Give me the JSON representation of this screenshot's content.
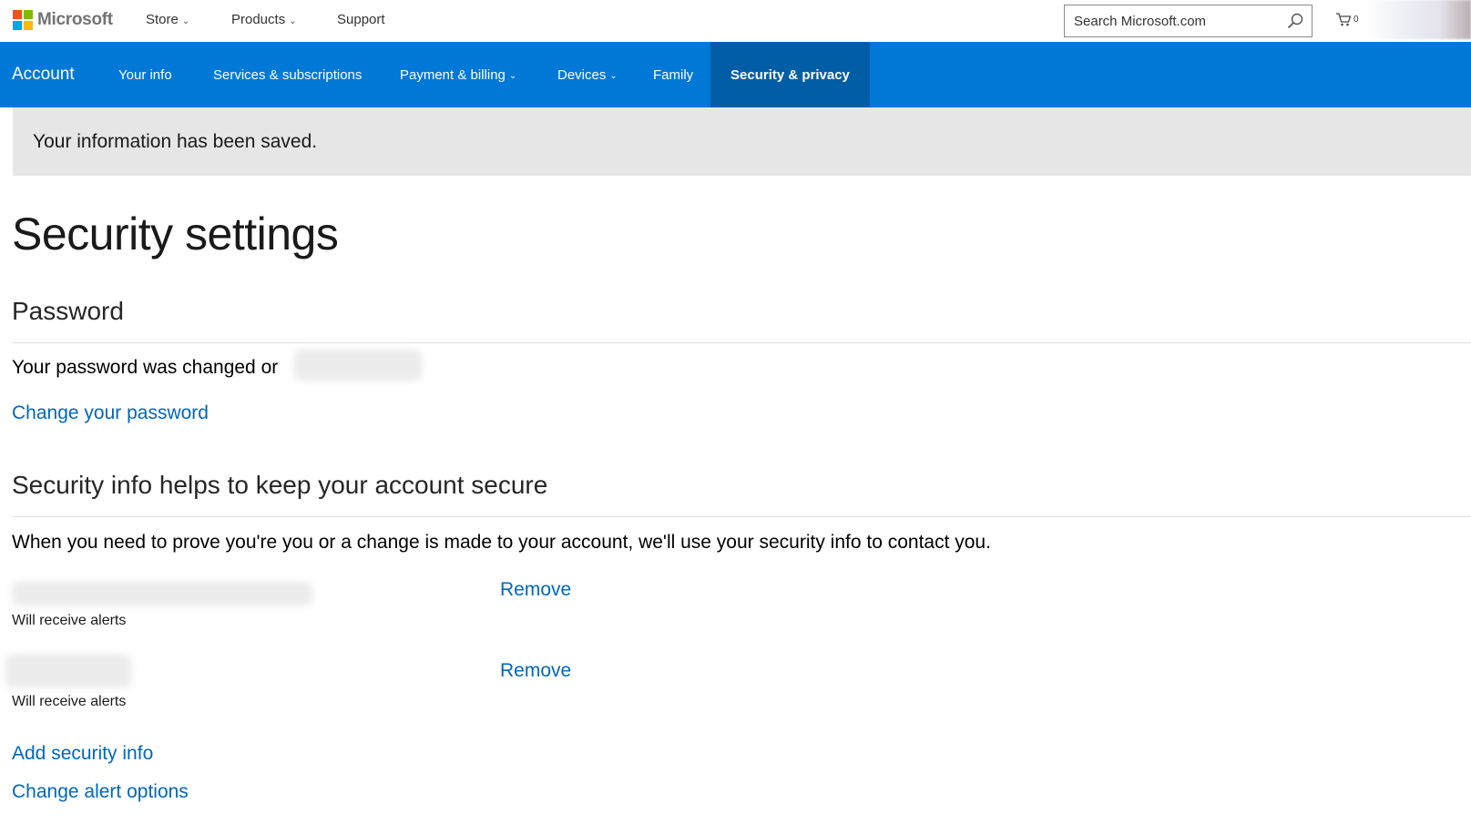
{
  "header": {
    "brand": "Microsoft",
    "nav": [
      {
        "label": "Store",
        "has_dropdown": true
      },
      {
        "label": "Products",
        "has_dropdown": true
      },
      {
        "label": "Support",
        "has_dropdown": false
      }
    ],
    "search_placeholder": "Search Microsoft.com",
    "cart_count": "0",
    "logo_colors": [
      "#f25022",
      "#7fba00",
      "#00a4ef",
      "#ffb900"
    ]
  },
  "account_nav": {
    "title": "Account",
    "items": [
      {
        "label": "Your info",
        "has_dropdown": false,
        "active": false
      },
      {
        "label": "Services & subscriptions",
        "has_dropdown": false,
        "active": false
      },
      {
        "label": "Payment & billing",
        "has_dropdown": true,
        "active": false
      },
      {
        "label": "Devices",
        "has_dropdown": true,
        "active": false
      },
      {
        "label": "Family",
        "has_dropdown": false,
        "active": false
      },
      {
        "label": "Security & privacy",
        "has_dropdown": false,
        "active": true
      }
    ],
    "bar_color": "#0078d7",
    "active_color": "#005da6"
  },
  "banner": {
    "message": "Your information has been saved."
  },
  "page": {
    "title": "Security settings",
    "password_section": {
      "heading": "Password",
      "status_text": "Your password was changed or",
      "change_link": "Change your password"
    },
    "security_info_section": {
      "heading": "Security info helps to keep your account secure",
      "description": "When you need to prove you're you or a change is made to your account, we'll use your security info to contact you.",
      "entries": [
        {
          "subtitle": "Will receive alerts",
          "action": "Remove"
        },
        {
          "subtitle": "Will receive alerts",
          "action": "Remove"
        }
      ],
      "add_link": "Add security info",
      "alert_link": "Change alert options"
    },
    "link_color": "#0067b8"
  }
}
